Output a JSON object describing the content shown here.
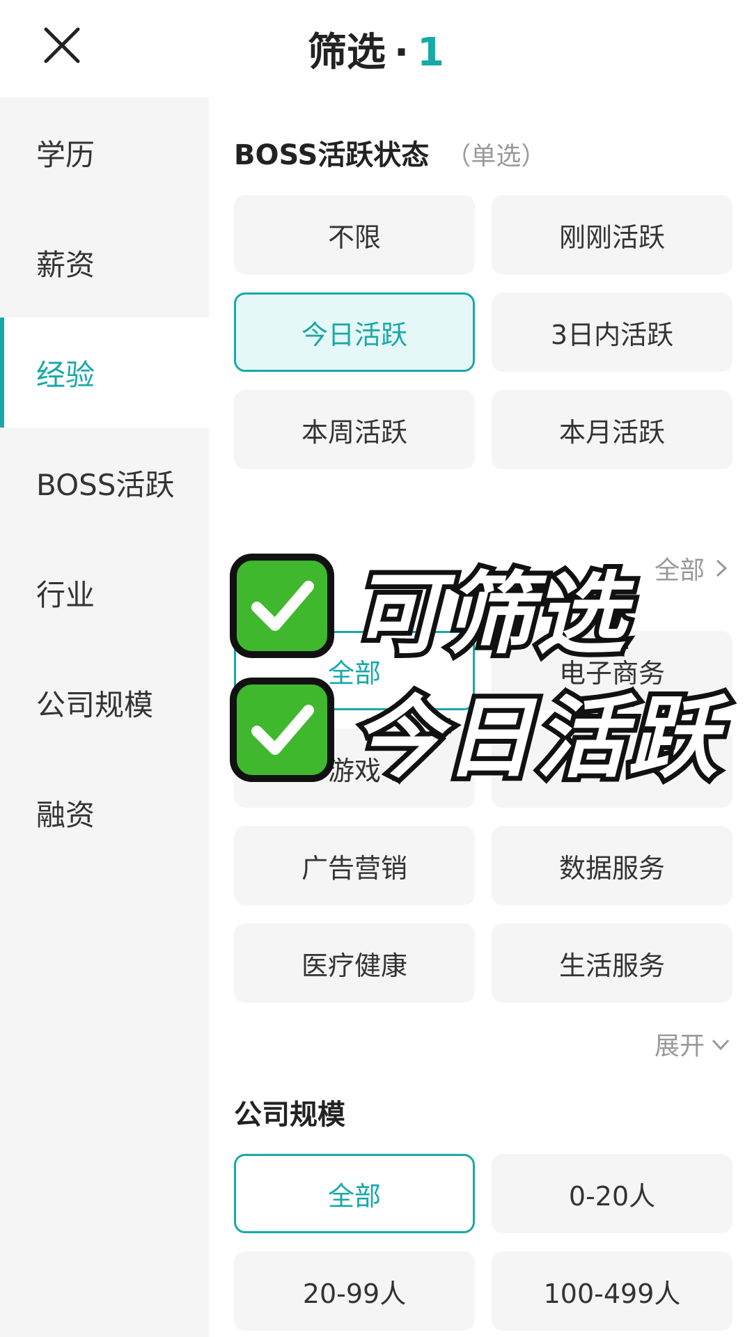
{
  "header": {
    "title": "筛选",
    "dot": "·",
    "count": "1"
  },
  "sidebar": {
    "items": [
      {
        "label": "学历"
      },
      {
        "label": "薪资"
      },
      {
        "label": "经验"
      },
      {
        "label": "BOSS活跃"
      },
      {
        "label": "行业"
      },
      {
        "label": "公司规模"
      },
      {
        "label": "融资"
      }
    ]
  },
  "boss_section": {
    "title": "BOSS活跃状态",
    "hint": "（单选）",
    "options": [
      "不限",
      "刚刚活跃",
      "今日活跃",
      "3日内活跃",
      "本周活跃",
      "本月活跃"
    ],
    "selected": "今日活跃"
  },
  "industry_section": {
    "link": "全部",
    "options": [
      "全部",
      "电子商务",
      "游戏",
      "",
      "广告营销",
      "数据服务",
      "医疗健康",
      "生活服务"
    ],
    "expand": "展开"
  },
  "size_section": {
    "title": "公司规模",
    "options": [
      "全部",
      "0-20人",
      "20-99人",
      "100-499人"
    ],
    "selected": "全部"
  },
  "overlay": {
    "line1": "可筛选",
    "line2": "今日活跃"
  },
  "colors": {
    "accent": "#19a8a8",
    "check_green": "#3fb82e"
  },
  "icons": {
    "close": "close-icon",
    "chevron_right": "chevron-right-icon",
    "chevron_down": "chevron-down-icon",
    "check": "checkmark-icon"
  }
}
